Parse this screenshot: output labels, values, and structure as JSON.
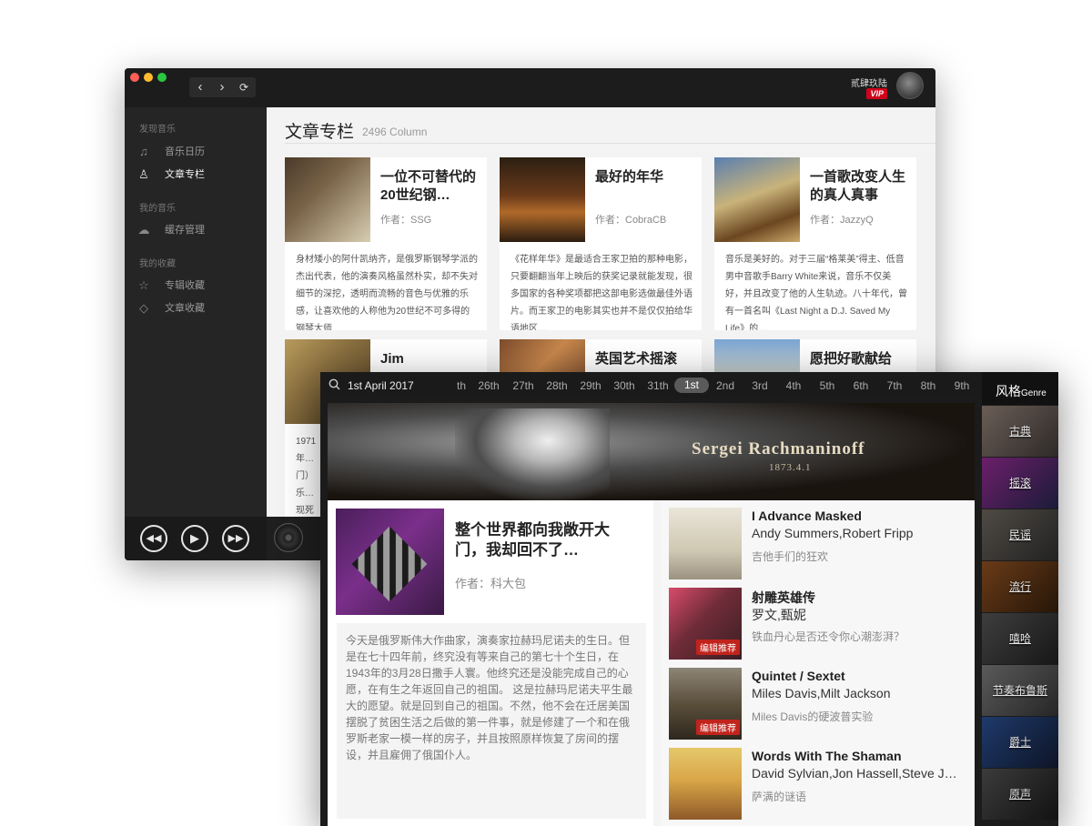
{
  "win1": {
    "nav": {
      "back": "‹",
      "forward": "›",
      "refresh": "⟳"
    },
    "user": {
      "name": "贰肆玖陆",
      "vip": "VIP"
    },
    "sidebar": {
      "sections": [
        {
          "title": "发现音乐",
          "items": [
            {
              "icon": "♫",
              "label": "音乐日历"
            },
            {
              "icon": "♙",
              "label": "文章专栏"
            }
          ]
        },
        {
          "title": "我的音乐",
          "items": [
            {
              "icon": "☁",
              "label": "缓存管理"
            }
          ]
        },
        {
          "title": "我的收藏",
          "items": [
            {
              "icon": "☆",
              "label": "专辑收藏"
            },
            {
              "icon": "◇",
              "label": "文章收藏"
            }
          ]
        }
      ]
    },
    "player": {
      "prev": "◀◀",
      "play": "▶",
      "next": "▶▶"
    },
    "main": {
      "title": "文章专栏",
      "count": "2496 Column",
      "cards": [
        {
          "title": "一位不可替代的20世纪钢…",
          "author": "作者：SSG",
          "excerpt": "身材矮小的阿什凯纳齐，是俄罗斯钢琴学派的杰出代表，他的演奏风格虽然朴实，却不失对细节的深挖，透明而流畅的音色与优雅的乐感，让喜欢他的人称他为20世纪不可多得的钢琴大师"
        },
        {
          "title": "最好的年华",
          "author": "作者：CobraCB",
          "excerpt": "《花样年华》是最适合王家卫拍的那种电影，只要翻翻当年上映后的获奖记录就能发现，很多国家的各种奖项都把这部电影选做最佳外语片。而王家卫的电影其实也并不是仅仅拍给华语地区…"
        },
        {
          "title": "一首歌改变人生的真人真事",
          "author": "作者：JazzyQ",
          "excerpt": "音乐是美好的。对于三届“格莱美”得主、低音男中音歌手Barry White来说，音乐不仅美好，并且改变了他的人生轨迹。八十年代，曾有一首名叫《Last Night a D.J. Saved My Life》的…"
        },
        {
          "title": "Jim",
          "author": "",
          "excerpt": "1971年…门）乐…现死于…天纪念…"
        },
        {
          "title": "英国艺术摇滚",
          "author": "",
          "excerpt": ""
        },
        {
          "title": "愿把好歌献给",
          "author": "",
          "excerpt": ""
        }
      ]
    }
  },
  "win2": {
    "date": "1st April 2017",
    "days": [
      "th",
      "26th",
      "27th",
      "28th",
      "29th",
      "30th",
      "31th",
      "1st",
      "2nd",
      "3rd",
      "4th",
      "5th",
      "6th",
      "7th",
      "8th",
      "9th"
    ],
    "active_day": "1st",
    "banner": {
      "name": "Sergei Rachmaninoff",
      "date": "1873.4.1"
    },
    "feature": {
      "title": "整个世界都向我敞开大门，我却回不了…",
      "author": "作者：科大包",
      "text": "今天是俄罗斯伟大作曲家，演奏家拉赫玛尼诺夫的生日。但是在七十四年前，终究没有等来自己的第七十个生日，在1943年的3月28日撒手人寰。他终究还是没能完成自己的心愿，在有生之年返回自己的祖国。 这是拉赫玛尼诺夫平生最大的愿望。就是回到自己的祖国。不然，他不会在迁居美国摆脱了贫困生活之后做的第一件事，就是修建了一个和在俄罗斯老家一模一样的房子，并且按照原样恢复了房间的摆设，并且雇佣了俄国仆人。"
    },
    "list": [
      {
        "title": "I Advance Masked",
        "artist": "Andy Summers,Robert Fripp",
        "desc": "吉他手们的狂欢",
        "tag": ""
      },
      {
        "title": "射雕英雄传",
        "artist": "罗文,甄妮",
        "desc": "铁血丹心是否还令你心潮澎湃？",
        "tag": "编辑推荐"
      },
      {
        "title": "Quintet / Sextet",
        "artist": "Miles Davis,Milt Jackson",
        "desc": "Miles Davis的硬波普实验",
        "tag": "编辑推荐"
      },
      {
        "title": "Words With The Shaman",
        "artist": "David Sylvian,Jon Hassell,Steve J…",
        "desc": "萨满的谜语",
        "tag": ""
      }
    ],
    "genre": {
      "title": "风格",
      "subtitle": "Genre",
      "items": [
        "古典",
        "摇滚",
        "民谣",
        "流行",
        "嘻哈",
        "节奏布鲁斯",
        "爵士",
        "原声"
      ]
    }
  }
}
